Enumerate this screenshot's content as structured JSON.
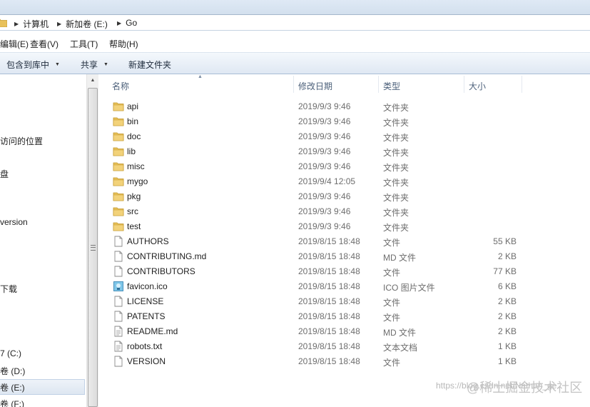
{
  "address_bar": {
    "segments": [
      "计算机",
      "新加卷 (E:)",
      "Go"
    ]
  },
  "menu": {
    "items": [
      "编辑(E)",
      "查看(V)",
      "工具(T)",
      "帮助(H)"
    ]
  },
  "toolbar": {
    "include_label": "包含到库中",
    "share_label": "共享",
    "new_folder_label": "新建文件夹"
  },
  "nav": {
    "items": [
      "访问的位置",
      "盘",
      "version",
      "下载",
      "7 (C:)",
      "卷 (D:)",
      "卷 (E:)",
      "卷 (F:)"
    ],
    "selected": "卷 (E:)"
  },
  "columns": {
    "name": "名称",
    "date": "修改日期",
    "type": "类型",
    "size": "大小"
  },
  "files": [
    {
      "name": "api",
      "date": "2019/9/3 9:46",
      "type": "文件夹",
      "size": "",
      "icon": "folder-icon"
    },
    {
      "name": "bin",
      "date": "2019/9/3 9:46",
      "type": "文件夹",
      "size": "",
      "icon": "folder-icon"
    },
    {
      "name": "doc",
      "date": "2019/9/3 9:46",
      "type": "文件夹",
      "size": "",
      "icon": "folder-icon"
    },
    {
      "name": "lib",
      "date": "2019/9/3 9:46",
      "type": "文件夹",
      "size": "",
      "icon": "folder-icon"
    },
    {
      "name": "misc",
      "date": "2019/9/3 9:46",
      "type": "文件夹",
      "size": "",
      "icon": "folder-icon"
    },
    {
      "name": "mygo",
      "date": "2019/9/4 12:05",
      "type": "文件夹",
      "size": "",
      "icon": "folder-icon"
    },
    {
      "name": "pkg",
      "date": "2019/9/3 9:46",
      "type": "文件夹",
      "size": "",
      "icon": "folder-icon"
    },
    {
      "name": "src",
      "date": "2019/9/3 9:46",
      "type": "文件夹",
      "size": "",
      "icon": "folder-icon"
    },
    {
      "name": "test",
      "date": "2019/9/3 9:46",
      "type": "文件夹",
      "size": "",
      "icon": "folder-icon"
    },
    {
      "name": "AUTHORS",
      "date": "2019/8/15 18:48",
      "type": "文件",
      "size": "55 KB",
      "icon": "file-icon"
    },
    {
      "name": "CONTRIBUTING.md",
      "date": "2019/8/15 18:48",
      "type": "MD 文件",
      "size": "2 KB",
      "icon": "file-icon"
    },
    {
      "name": "CONTRIBUTORS",
      "date": "2019/8/15 18:48",
      "type": "文件",
      "size": "77 KB",
      "icon": "file-icon"
    },
    {
      "name": "favicon.ico",
      "date": "2019/8/15 18:48",
      "type": "ICO 图片文件",
      "size": "6 KB",
      "icon": "image-icon"
    },
    {
      "name": "LICENSE",
      "date": "2019/8/15 18:48",
      "type": "文件",
      "size": "2 KB",
      "icon": "file-icon"
    },
    {
      "name": "PATENTS",
      "date": "2019/8/15 18:48",
      "type": "文件",
      "size": "2 KB",
      "icon": "file-icon"
    },
    {
      "name": "README.md",
      "date": "2019/8/15 18:48",
      "type": "MD 文件",
      "size": "2 KB",
      "icon": "text-file-icon"
    },
    {
      "name": "robots.txt",
      "date": "2019/8/15 18:48",
      "type": "文本文档",
      "size": "1 KB",
      "icon": "text-file-icon"
    },
    {
      "name": "VERSION",
      "date": "2019/8/15 18:48",
      "type": "文件",
      "size": "1 KB",
      "icon": "file-icon"
    }
  ],
  "watermark": {
    "url": "https://blog.csdn.net/Nathan_ge",
    "brand": "@稀土掘金技术社区"
  },
  "colors": {
    "toolbar_bg": "#dfe8f3",
    "folder": "#e8c15a",
    "header_text": "#4c607a"
  }
}
